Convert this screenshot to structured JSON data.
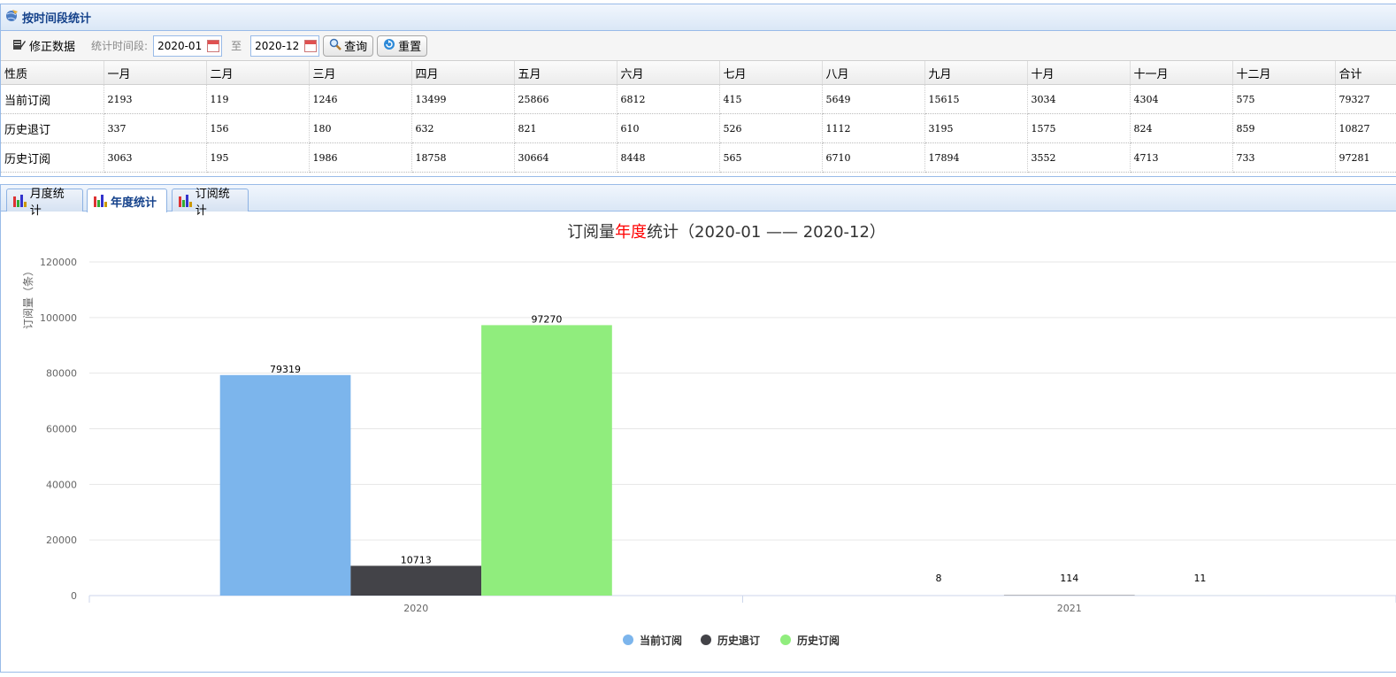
{
  "top_panel": {
    "title": "按时间段统计"
  },
  "toolbar": {
    "fix_label": "修正数据",
    "period_label": "统计时间段:",
    "start": "2020-01",
    "to_label": "至",
    "end": "2020-12",
    "query_label": "查询",
    "reset_label": "重置"
  },
  "grid": {
    "headers": [
      "性质",
      "一月",
      "二月",
      "三月",
      "四月",
      "五月",
      "六月",
      "七月",
      "八月",
      "九月",
      "十月",
      "十一月",
      "十二月",
      "合计"
    ],
    "rows": [
      {
        "name": "当前订阅",
        "cells": [
          "2193",
          "119",
          "1246",
          "13499",
          "25866",
          "6812",
          "415",
          "5649",
          "15615",
          "3034",
          "4304",
          "575",
          "79327"
        ]
      },
      {
        "name": "历史退订",
        "cells": [
          "337",
          "156",
          "180",
          "632",
          "821",
          "610",
          "526",
          "1112",
          "3195",
          "1575",
          "824",
          "859",
          "10827"
        ]
      },
      {
        "name": "历史订阅",
        "cells": [
          "3063",
          "195",
          "1986",
          "18758",
          "30664",
          "8448",
          "565",
          "6710",
          "17894",
          "3552",
          "4713",
          "733",
          "97281"
        ]
      }
    ]
  },
  "tabs": [
    {
      "label": "月度统计",
      "active": false
    },
    {
      "label": "年度统计",
      "active": true
    },
    {
      "label": "订阅统计",
      "active": false
    }
  ],
  "chart_data": {
    "type": "bar",
    "title_parts": [
      "订阅量",
      "年度",
      "统计（2020-01 —— 2020-12）"
    ],
    "title_highlight_color": "#ff0000",
    "ylabel": "订阅量（条）",
    "ylim": [
      0,
      120000
    ],
    "yticks": [
      "0",
      "20000",
      "40000",
      "60000",
      "80000",
      "100000",
      "120000"
    ],
    "categories": [
      "2020",
      "2021"
    ],
    "series": [
      {
        "name": "当前订阅",
        "color": "#7cb5ec",
        "values": [
          79319,
          8
        ]
      },
      {
        "name": "历史退订",
        "color": "#434348",
        "values": [
          10713,
          114
        ]
      },
      {
        "name": "历史订阅",
        "color": "#90ed7d",
        "values": [
          97270,
          11
        ]
      }
    ],
    "legend_position": "bottom-center",
    "grid": true
  }
}
